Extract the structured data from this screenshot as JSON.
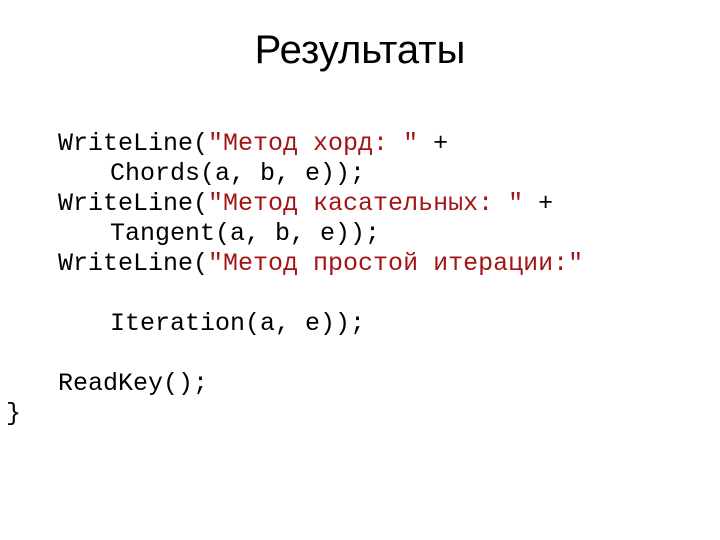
{
  "title": "Результаты",
  "code": {
    "l1a": "WriteLine(",
    "l1b": "\"Метод хорд: \"",
    "l1c": " +",
    "l2": "Chords(a, b, e));",
    "l3a": "WriteLine(",
    "l3b": "\"Метод касательных: \"",
    "l3c": " +",
    "l4": "Tangent(a, b, e));",
    "l5a": "WriteLine(",
    "l5b": "\"Метод простой итерации:\"",
    "l6": "Iteration(a, e));",
    "l7": "ReadKey();",
    "l8": "}"
  }
}
